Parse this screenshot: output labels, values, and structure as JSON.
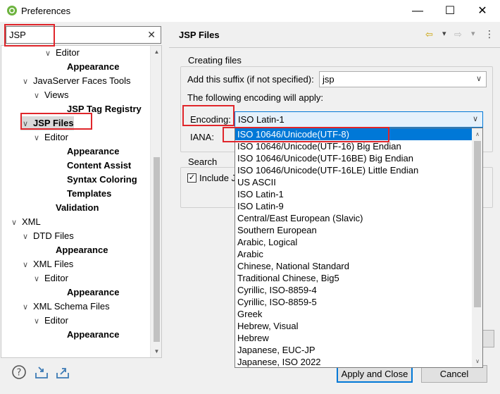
{
  "window": {
    "title": "Preferences",
    "minimize_glyph": "—",
    "maximize_glyph": "☐",
    "close_glyph": "✕"
  },
  "filter": {
    "value": "JSP",
    "clear_glyph": "✕"
  },
  "tree": {
    "items": [
      {
        "label": "Editor",
        "twisty": "∨",
        "bold": false
      },
      {
        "label": "Appearance",
        "twisty": "",
        "bold": true
      },
      {
        "label": "JavaServer Faces Tools",
        "twisty": "∨",
        "bold": false
      },
      {
        "label": "Views",
        "twisty": "∨",
        "bold": false
      },
      {
        "label": "JSP Tag Registry",
        "twisty": "",
        "bold": true
      },
      {
        "label": "JSP Files",
        "twisty": "∨",
        "bold": true
      },
      {
        "label": "Editor",
        "twisty": "∨",
        "bold": false
      },
      {
        "label": "Appearance",
        "twisty": "",
        "bold": true
      },
      {
        "label": "Content Assist",
        "twisty": "",
        "bold": true
      },
      {
        "label": "Syntax Coloring",
        "twisty": "",
        "bold": true
      },
      {
        "label": "Templates",
        "twisty": "",
        "bold": true
      },
      {
        "label": "Validation",
        "twisty": "",
        "bold": true
      },
      {
        "label": "XML",
        "twisty": "∨",
        "bold": false
      },
      {
        "label": "DTD Files",
        "twisty": "∨",
        "bold": false
      },
      {
        "label": "Appearance",
        "twisty": "",
        "bold": true
      },
      {
        "label": "XML Files",
        "twisty": "∨",
        "bold": false
      },
      {
        "label": "Editor",
        "twisty": "∨",
        "bold": false
      },
      {
        "label": "Appearance",
        "twisty": "",
        "bold": true
      },
      {
        "label": "XML Schema Files",
        "twisty": "∨",
        "bold": false
      },
      {
        "label": "Editor",
        "twisty": "∨",
        "bold": false
      },
      {
        "label": "Appearance",
        "twisty": "",
        "bold": true
      }
    ]
  },
  "page": {
    "title": "JSP Files",
    "back_glyph": "⇦",
    "forward_glyph": "⇨",
    "menu_glyph": "⋮",
    "dropdown_glyph": "▾"
  },
  "creating_files": {
    "group_label": "Creating files",
    "suffix_label": "Add this suffix (if not specified):",
    "suffix_value": "jsp",
    "encoding_note": "The following encoding will apply:",
    "encoding_label": "Encoding:",
    "encoding_value": "ISO Latin-1",
    "iana_label": "IANA:"
  },
  "search": {
    "group_label": "Search",
    "include_label": "Include J"
  },
  "encoding_options": [
    "ISO 10646/Unicode(UTF-8)",
    "ISO 10646/Unicode(UTF-16) Big Endian",
    "ISO 10646/Unicode(UTF-16BE) Big Endian",
    "ISO 10646/Unicode(UTF-16LE) Little Endian",
    "US ASCII",
    "ISO Latin-1",
    "ISO Latin-9",
    "Central/East European (Slavic)",
    "Southern European",
    "Arabic, Logical",
    "Arabic",
    "Chinese, National Standard",
    "Traditional Chinese, Big5",
    "Cyrillic, ISO-8859-4",
    "Cyrillic, ISO-8859-5",
    "Greek",
    "Hebrew, Visual",
    "Hebrew",
    "Japanese, EUC-JP",
    "Japanese, ISO 2022"
  ],
  "buttons": {
    "apply_close": "Apply and Close",
    "cancel": "Cancel"
  },
  "colors": {
    "selection": "#0078d7",
    "highlight": "#e0262b"
  }
}
